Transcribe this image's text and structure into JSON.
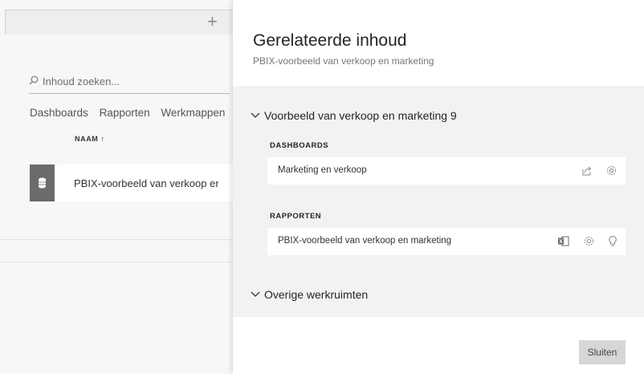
{
  "left_pane": {
    "search_placeholder": "Inhoud zoeken...",
    "tabs": [
      "Dashboards",
      "Rapporten",
      "Werkmappen"
    ],
    "column_header": "NAAM ↑",
    "row_name": "PBIX-voorbeeld van verkoop en marketing"
  },
  "panel": {
    "title": "Gerelateerde inhoud",
    "subtitle": "PBIX-voorbeeld van verkoop en marketing",
    "workspace_section": "Voorbeeld van verkoop en marketing 9",
    "dashboards_label": "DASHBOARDS",
    "dashboard_item": "Marketing en verkoop",
    "reports_label": "RAPPORTEN",
    "report_item": "PBIX-voorbeeld van verkoop en marketing",
    "other_section": "Overige werkruimten",
    "close_button": "Sluiten"
  },
  "colors": {
    "panel_grey": "#f3f2f1",
    "tile_grey": "#6b6b6b",
    "button_grey": "#d6d6d6"
  },
  "icons": {
    "plus": "plus-icon",
    "search": "search-icon",
    "dataset": "database-icon",
    "share": "share-icon",
    "settings": "gear-icon",
    "excel": "excel-icon",
    "insights": "lightbulb-icon",
    "chevron": "chevron-down-icon"
  }
}
